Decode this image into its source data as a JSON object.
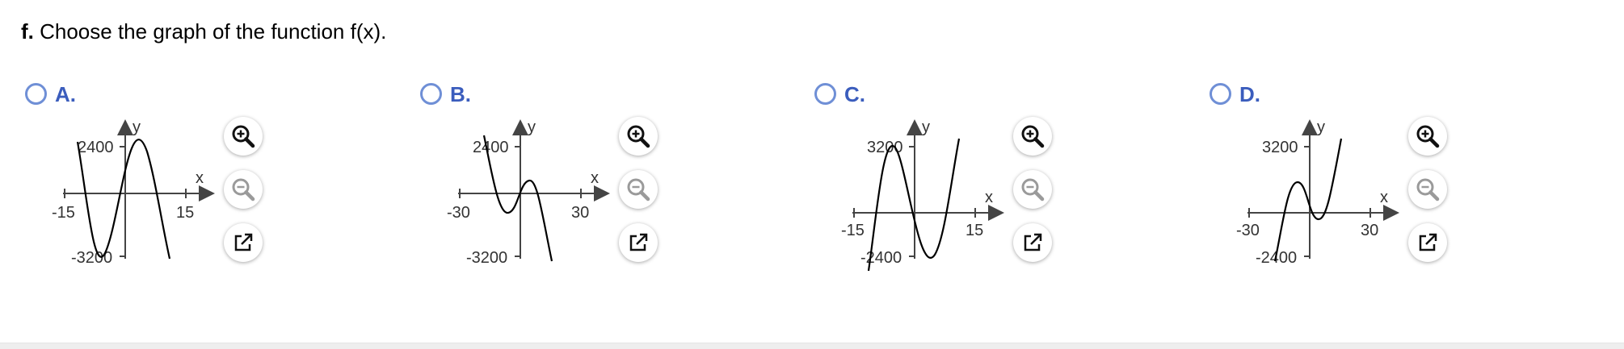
{
  "question": {
    "prefix": "f.",
    "text": " Choose the graph of the function f(x)."
  },
  "options": [
    {
      "label": "A.",
      "chart": {
        "type": "line",
        "x_label": "x",
        "y_label": "y",
        "x_ticks": [
          "-15",
          "15"
        ],
        "y_ticks": [
          "2400",
          "-3200"
        ],
        "xlim": [
          -15,
          15
        ],
        "ylim": [
          -3200,
          2400
        ],
        "curve": "cubic, negative leading coefficient: local min ≈ -3200 near x ≈ -10, local max ≈ 2400 near x ≈ 5"
      }
    },
    {
      "label": "B.",
      "chart": {
        "type": "line",
        "x_label": "x",
        "y_label": "y",
        "x_ticks": [
          "-30",
          "30"
        ],
        "y_ticks": [
          "2400",
          "-3200"
        ],
        "xlim": [
          -30,
          30
        ],
        "ylim": [
          -3200,
          2400
        ],
        "curve": "cubic, negative leading coefficient: local min near x ≈ -12, local max near x ≈ 8, falls steeply for x > 12"
      }
    },
    {
      "label": "C.",
      "chart": {
        "type": "line",
        "x_label": "x",
        "y_label": "y",
        "x_ticks": [
          "-15",
          "15"
        ],
        "y_ticks": [
          "3200",
          "-2400"
        ],
        "xlim": [
          -15,
          15
        ],
        "ylim": [
          -2400,
          3200
        ],
        "curve": "cubic, positive leading coefficient: local max ≈ 3200 near x ≈ -5, local min ≈ -2400 near x ≈ 5"
      }
    },
    {
      "label": "D.",
      "chart": {
        "type": "line",
        "x_label": "x",
        "y_label": "y",
        "x_ticks": [
          "-30",
          "30"
        ],
        "y_ticks": [
          "3200",
          "-2400"
        ],
        "xlim": [
          -30,
          30
        ],
        "ylim": [
          -2400,
          3200
        ],
        "curve": "cubic, positive leading coefficient: local max near x ≈ -12, local min near x ≈ 8, rises steeply for x > 12"
      }
    }
  ],
  "tools": {
    "zoom_in": "zoom-in-icon",
    "zoom_out": "zoom-out-icon",
    "popout": "popout-icon"
  },
  "colors": {
    "accent": "#3b5dbd",
    "radio_border": "#6f8fd6",
    "axis": "#444444",
    "curve": "#000000"
  }
}
